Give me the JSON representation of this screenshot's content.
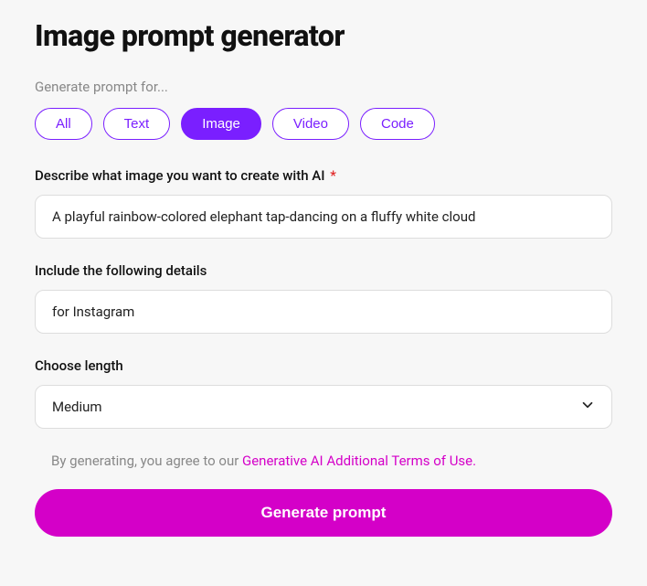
{
  "title": "Image prompt generator",
  "generate_for_label": "Generate prompt for...",
  "tabs": {
    "all": "All",
    "text": "Text",
    "image": "Image",
    "video": "Video",
    "code": "Code",
    "active": "image"
  },
  "describe": {
    "label": "Describe what image you want to create with AI",
    "required_mark": "*",
    "value": "A playful rainbow-colored elephant tap-dancing on a fluffy white cloud"
  },
  "details": {
    "label": "Include the following details",
    "value": "for Instagram"
  },
  "length": {
    "label": "Choose length",
    "selected": "Medium"
  },
  "terms": {
    "prefix": "By generating, you agree to our ",
    "link_text": "Generative AI Additional Terms of Use."
  },
  "generate_button": "Generate prompt"
}
